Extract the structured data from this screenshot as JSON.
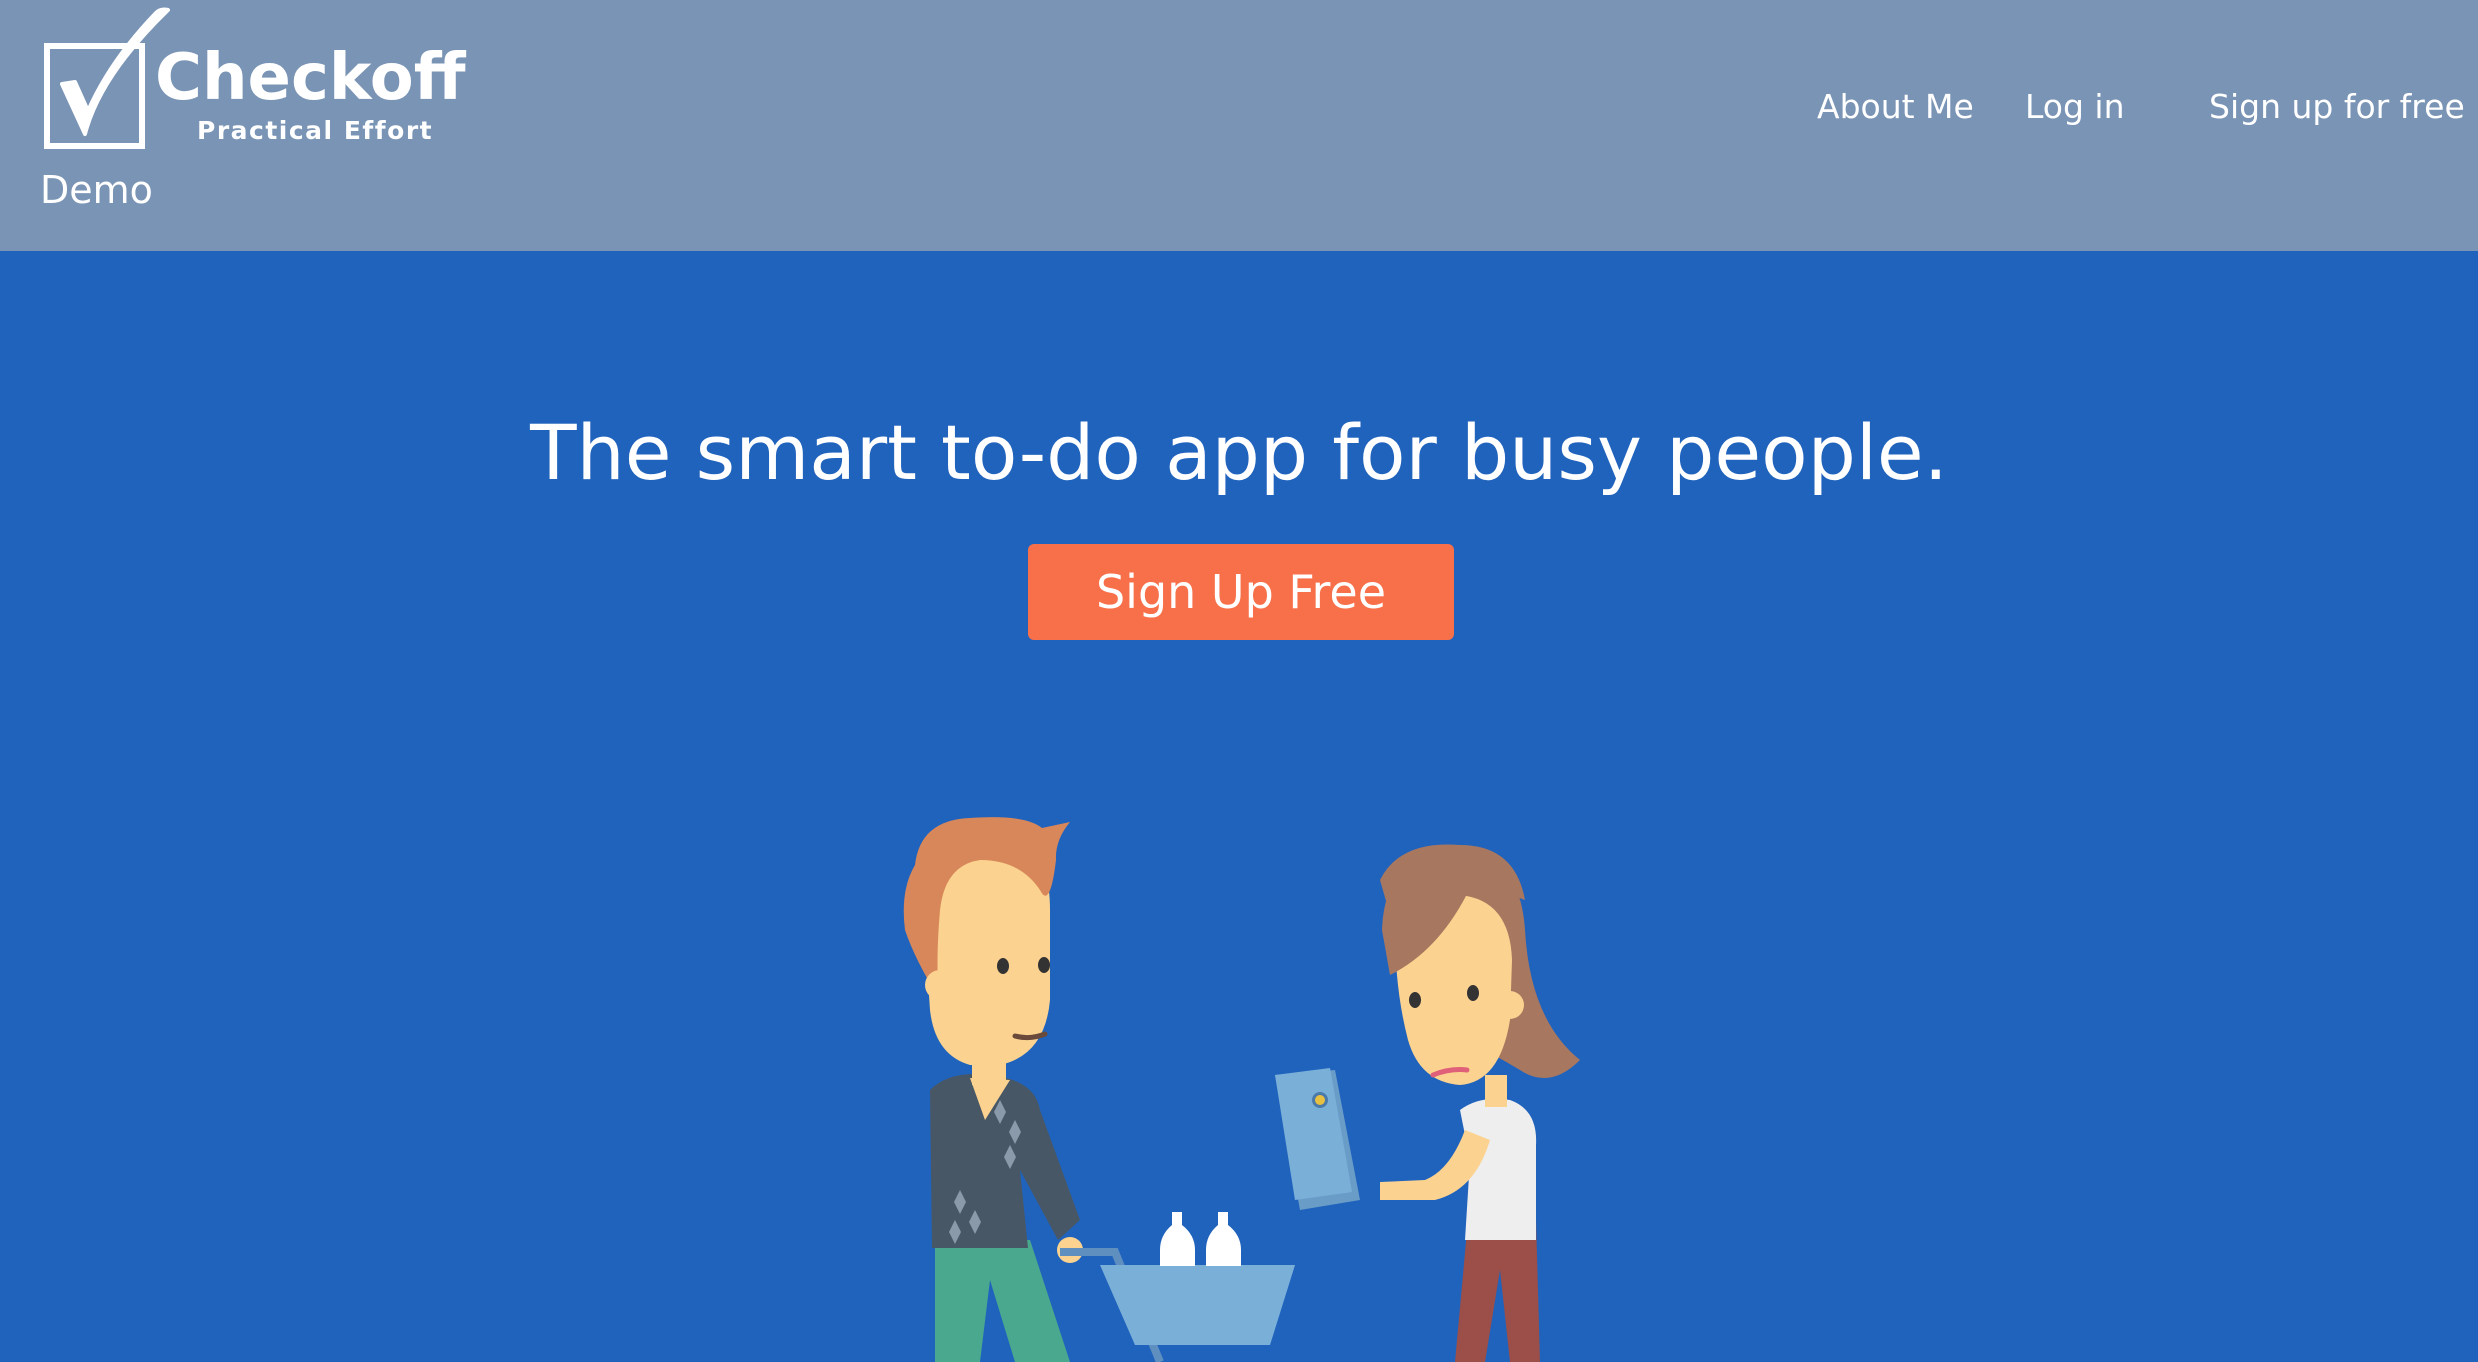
{
  "brand": {
    "name": "Checkoff",
    "tagline": "Practical Effort"
  },
  "nav": {
    "demo": "Demo",
    "about": "About Me",
    "login": "Log in",
    "signup": "Sign up for free"
  },
  "hero": {
    "title": "The smart to-do app for busy people.",
    "cta": "Sign Up Free"
  },
  "colors": {
    "navbar_bg": "#7a94b5",
    "hero_bg": "#2063bd",
    "cta_bg": "#f7704a",
    "text": "#ffffff"
  }
}
